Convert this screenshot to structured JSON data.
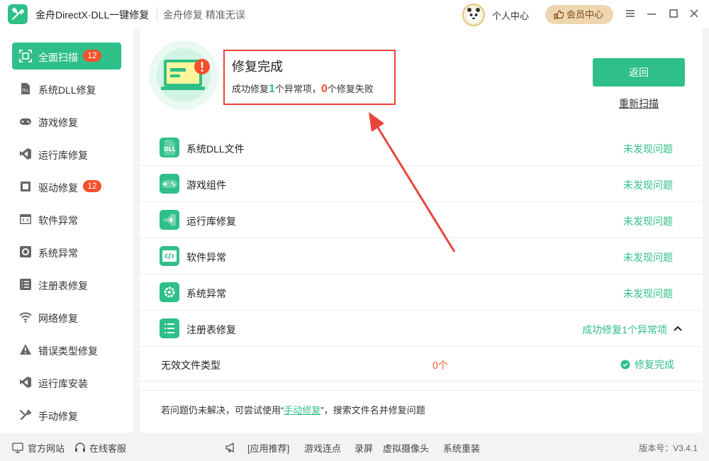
{
  "app": {
    "title": "金舟DirectX·DLL一键修复",
    "slogan": "金舟修复 精准无误",
    "user_center": "个人中心",
    "vip_center": "会员中心"
  },
  "sidebar": {
    "items": [
      {
        "label": "全面扫描",
        "badge": "12",
        "icon": "scan-icon"
      },
      {
        "label": "系统DLL修复",
        "icon": "dll-icon"
      },
      {
        "label": "游戏修复",
        "icon": "gamepad-icon"
      },
      {
        "label": "运行库修复",
        "icon": "visual-studio-icon"
      },
      {
        "label": "驱动修复",
        "badge": "12",
        "icon": "chip-icon"
      },
      {
        "label": "软件异常",
        "icon": "code-window-icon"
      },
      {
        "label": "系统异常",
        "icon": "gear-icon"
      },
      {
        "label": "注册表修复",
        "icon": "list-icon"
      },
      {
        "label": "网络修复",
        "icon": "wifi-icon"
      },
      {
        "label": "错误类型修复",
        "icon": "warning-icon"
      },
      {
        "label": "运行库安装",
        "icon": "visual-studio-icon"
      },
      {
        "label": "手动修复",
        "icon": "wrench-icon"
      }
    ]
  },
  "result": {
    "title": "修复完成",
    "sub_prefix": "成功修复",
    "fixed_count": "1",
    "sub_mid": "个异常项，",
    "failed_count": "0",
    "sub_suffix": "个修复失败",
    "back_label": "返回",
    "rescan_label": "重新扫描"
  },
  "rows": [
    {
      "label": "系统DLL文件",
      "status": "未发现问题",
      "icon": "dll-icon"
    },
    {
      "label": "游戏组件",
      "status": "未发现问题",
      "icon": "gamepad-icon"
    },
    {
      "label": "运行库修复",
      "status": "未发现问题",
      "icon": "visual-studio-icon"
    },
    {
      "label": "软件异常",
      "status": "未发现问题",
      "icon": "code-window-icon"
    },
    {
      "label": "系统异常",
      "status": "未发现问题",
      "icon": "gear-icon"
    },
    {
      "label": "注册表修复",
      "status": "成功修复1个异常项",
      "icon": "list-icon"
    }
  ],
  "detail": {
    "name": "无效文件类型",
    "count": "0个",
    "status": "修复完成"
  },
  "hint": {
    "prefix": "若问题仍未解决，可尝试使用“",
    "link": "手动修复",
    "suffix": "”，搜索文件名并修复问题"
  },
  "bottom": {
    "website": "官方网站",
    "support": "在线客服",
    "recommend": "[应用推荐]",
    "apps": [
      "游戏连点",
      "录屏",
      "虚拟摄像头",
      "系统重装"
    ],
    "version": "版本号：V3.4.1"
  },
  "colors": {
    "accent": "#2fbf88",
    "danger": "#f5502b",
    "highlight": "#e8453c",
    "vip": "#eed6b1"
  }
}
